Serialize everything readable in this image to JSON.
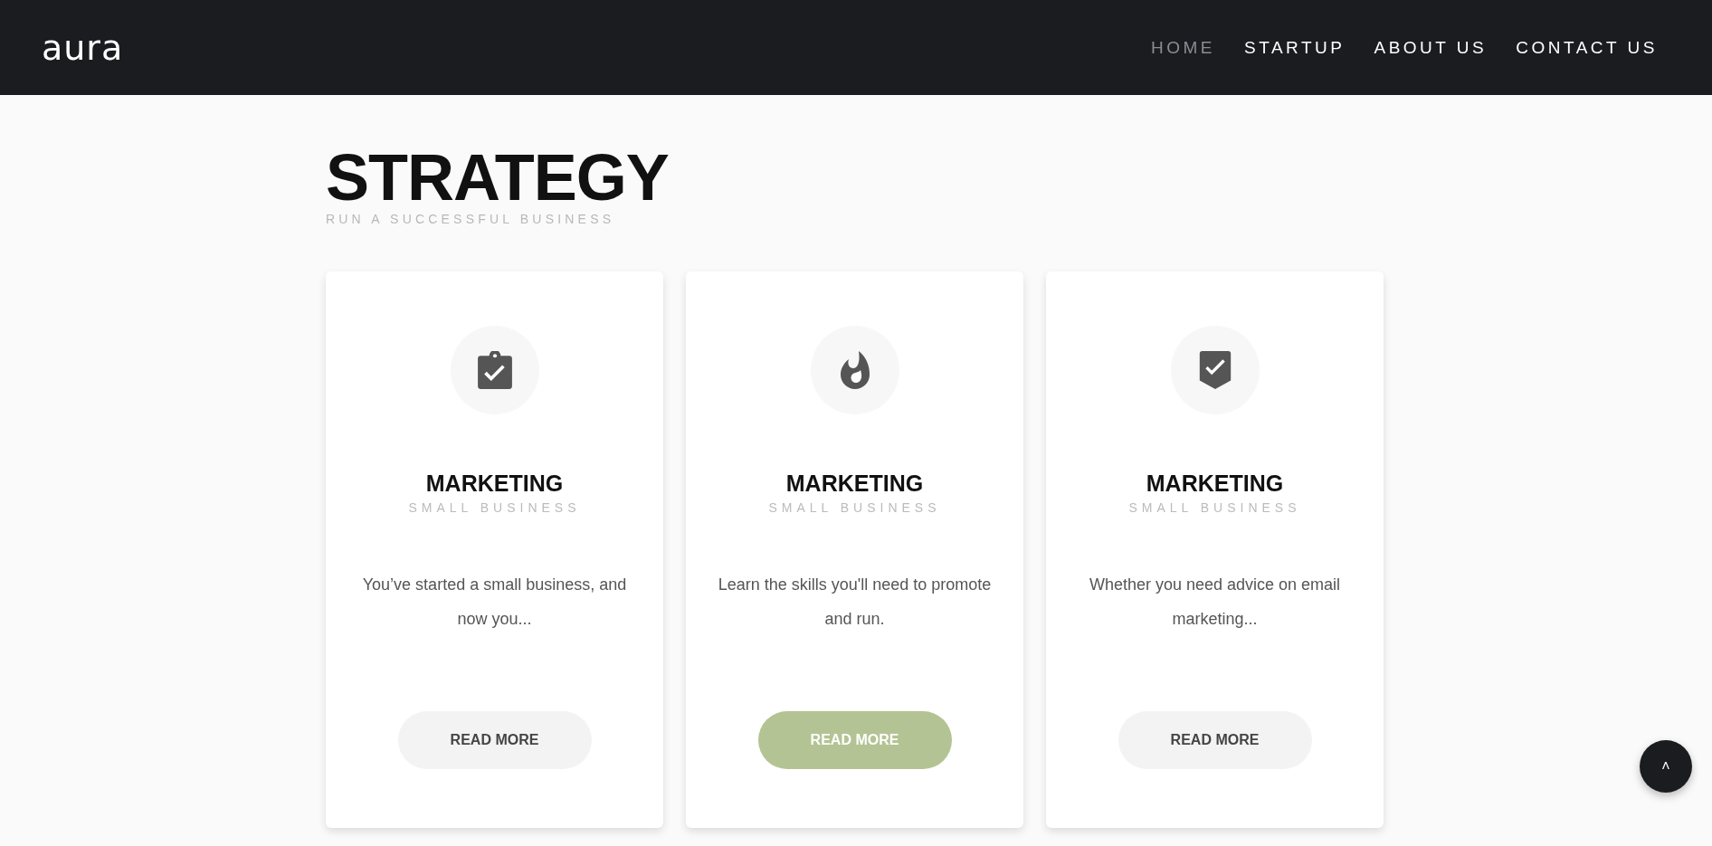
{
  "header": {
    "logo": "aura",
    "nav": [
      {
        "label": "HOME",
        "selected": true
      },
      {
        "label": "STARTUP",
        "selected": false
      },
      {
        "label": "ABOUT US",
        "selected": false
      },
      {
        "label": "CONTACT US",
        "selected": false
      }
    ]
  },
  "section": {
    "title": "STRATEGY",
    "subtitle": "RUN A SUCCESSFUL BUSINESS"
  },
  "cards": [
    {
      "kind": "clipboard",
      "title": "MARKETING",
      "subtitle": "SMALL BUSINESS",
      "text": "You’ve started a small business, and now you...",
      "button": "READ MORE",
      "highlighted": false
    },
    {
      "kind": "flame",
      "title": "MARKETING",
      "subtitle": "SMALL BUSINESS",
      "text": "Learn the skills you'll need to promote and run.",
      "button": "READ MORE",
      "highlighted": true
    },
    {
      "kind": "shield",
      "title": "MARKETING",
      "subtitle": "SMALL BUSINESS",
      "text": "Whether you need advice on email marketing...",
      "button": "READ MORE",
      "highlighted": false
    }
  ],
  "scroll_top": {
    "label": "˄"
  }
}
